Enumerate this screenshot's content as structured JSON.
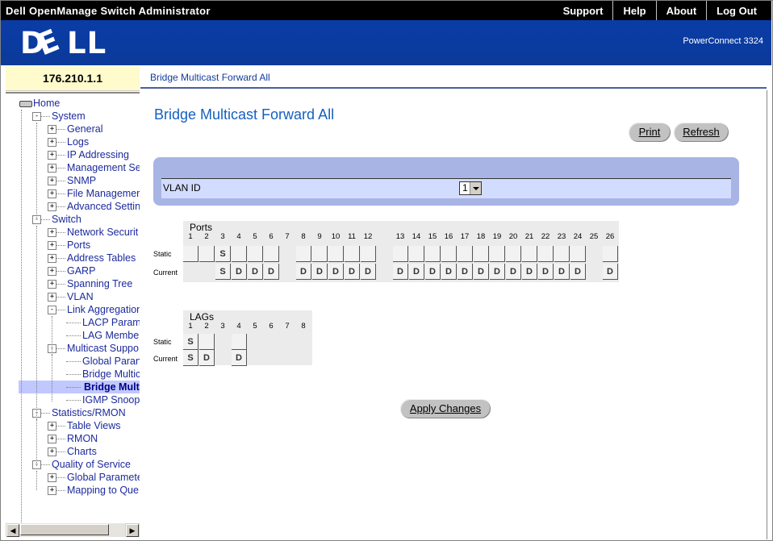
{
  "app": {
    "title": "Dell OpenManage Switch Administrator",
    "nav": [
      "Support",
      "Help",
      "About",
      "Log Out"
    ],
    "logo": "DELL",
    "model": "PowerConnect 3324"
  },
  "device": {
    "ip": "176.210.1.1"
  },
  "breadcrumb": "Bridge Multicast Forward All",
  "tree": [
    {
      "label": "Home",
      "depth": 0,
      "exp": ""
    },
    {
      "label": "System",
      "depth": 1,
      "exp": "-"
    },
    {
      "label": "General",
      "depth": 2,
      "exp": "+"
    },
    {
      "label": "Logs",
      "depth": 2,
      "exp": "+"
    },
    {
      "label": "IP Addressing",
      "depth": 2,
      "exp": "+"
    },
    {
      "label": "Management Se",
      "depth": 2,
      "exp": "+"
    },
    {
      "label": "SNMP",
      "depth": 2,
      "exp": "+"
    },
    {
      "label": "File Managemer",
      "depth": 2,
      "exp": "+"
    },
    {
      "label": "Advanced Settin",
      "depth": 2,
      "exp": "+"
    },
    {
      "label": "Switch",
      "depth": 1,
      "exp": "-"
    },
    {
      "label": "Network Securit",
      "depth": 2,
      "exp": "+"
    },
    {
      "label": "Ports",
      "depth": 2,
      "exp": "+"
    },
    {
      "label": "Address Tables",
      "depth": 2,
      "exp": "+"
    },
    {
      "label": "GARP",
      "depth": 2,
      "exp": "+"
    },
    {
      "label": "Spanning Tree",
      "depth": 2,
      "exp": "+"
    },
    {
      "label": "VLAN",
      "depth": 2,
      "exp": "+"
    },
    {
      "label": "Link Aggregation",
      "depth": 2,
      "exp": "-"
    },
    {
      "label": "LACP Param",
      "depth": 3,
      "exp": ""
    },
    {
      "label": "LAG Membe",
      "depth": 3,
      "exp": ""
    },
    {
      "label": "Multicast Suppo",
      "depth": 2,
      "exp": "-"
    },
    {
      "label": "Global Paran",
      "depth": 3,
      "exp": ""
    },
    {
      "label": "Bridge Multic",
      "depth": 3,
      "exp": ""
    },
    {
      "label": "Bridge Mult",
      "depth": 3,
      "exp": "",
      "selected": true
    },
    {
      "label": "IGMP Snoop",
      "depth": 3,
      "exp": ""
    },
    {
      "label": "Statistics/RMON",
      "depth": 1,
      "exp": "-"
    },
    {
      "label": "Table Views",
      "depth": 2,
      "exp": "+"
    },
    {
      "label": "RMON",
      "depth": 2,
      "exp": "+"
    },
    {
      "label": "Charts",
      "depth": 2,
      "exp": "+"
    },
    {
      "label": "Quality of Service",
      "depth": 1,
      "exp": "-"
    },
    {
      "label": "Global Paramete",
      "depth": 2,
      "exp": "+"
    },
    {
      "label": "Mapping to Que",
      "depth": 2,
      "exp": "+"
    }
  ],
  "page": {
    "title": "Bridge Multicast Forward All",
    "print_label": "Print",
    "refresh_label": "Refresh",
    "vlan_label": "VLAN ID",
    "vlan_value": "1",
    "apply_label": "Apply Changes",
    "static_label": "Static",
    "current_label": "Current"
  },
  "ports": {
    "title": "Ports",
    "numbers": [
      "1",
      "2",
      "3",
      "4",
      "5",
      "6",
      "7",
      "8",
      "9",
      "10",
      "11",
      "12",
      "13",
      "14",
      "15",
      "16",
      "17",
      "18",
      "19",
      "20",
      "21",
      "22",
      "23",
      "24",
      "25",
      "26"
    ],
    "static": [
      "",
      "",
      "S",
      "",
      "",
      "",
      null,
      "",
      "",
      "",
      "",
      "",
      "",
      "",
      "",
      "",
      "",
      "",
      "",
      "",
      "",
      "",
      "",
      "",
      null,
      ""
    ],
    "current": [
      null,
      null,
      "S",
      "D",
      "D",
      "D",
      null,
      "D",
      "D",
      "D",
      "D",
      "D",
      "D",
      "D",
      "D",
      "D",
      "D",
      "D",
      "D",
      "D",
      "D",
      "D",
      "D",
      "D",
      null,
      "D"
    ]
  },
  "lags": {
    "title": "LAGs",
    "numbers": [
      "1",
      "2",
      "3",
      "4",
      "5",
      "6",
      "7",
      "8"
    ],
    "static": [
      "S",
      "",
      null,
      "",
      null,
      null,
      null,
      null
    ],
    "current": [
      "S",
      "D",
      null,
      "D",
      null,
      null,
      null,
      null
    ]
  }
}
